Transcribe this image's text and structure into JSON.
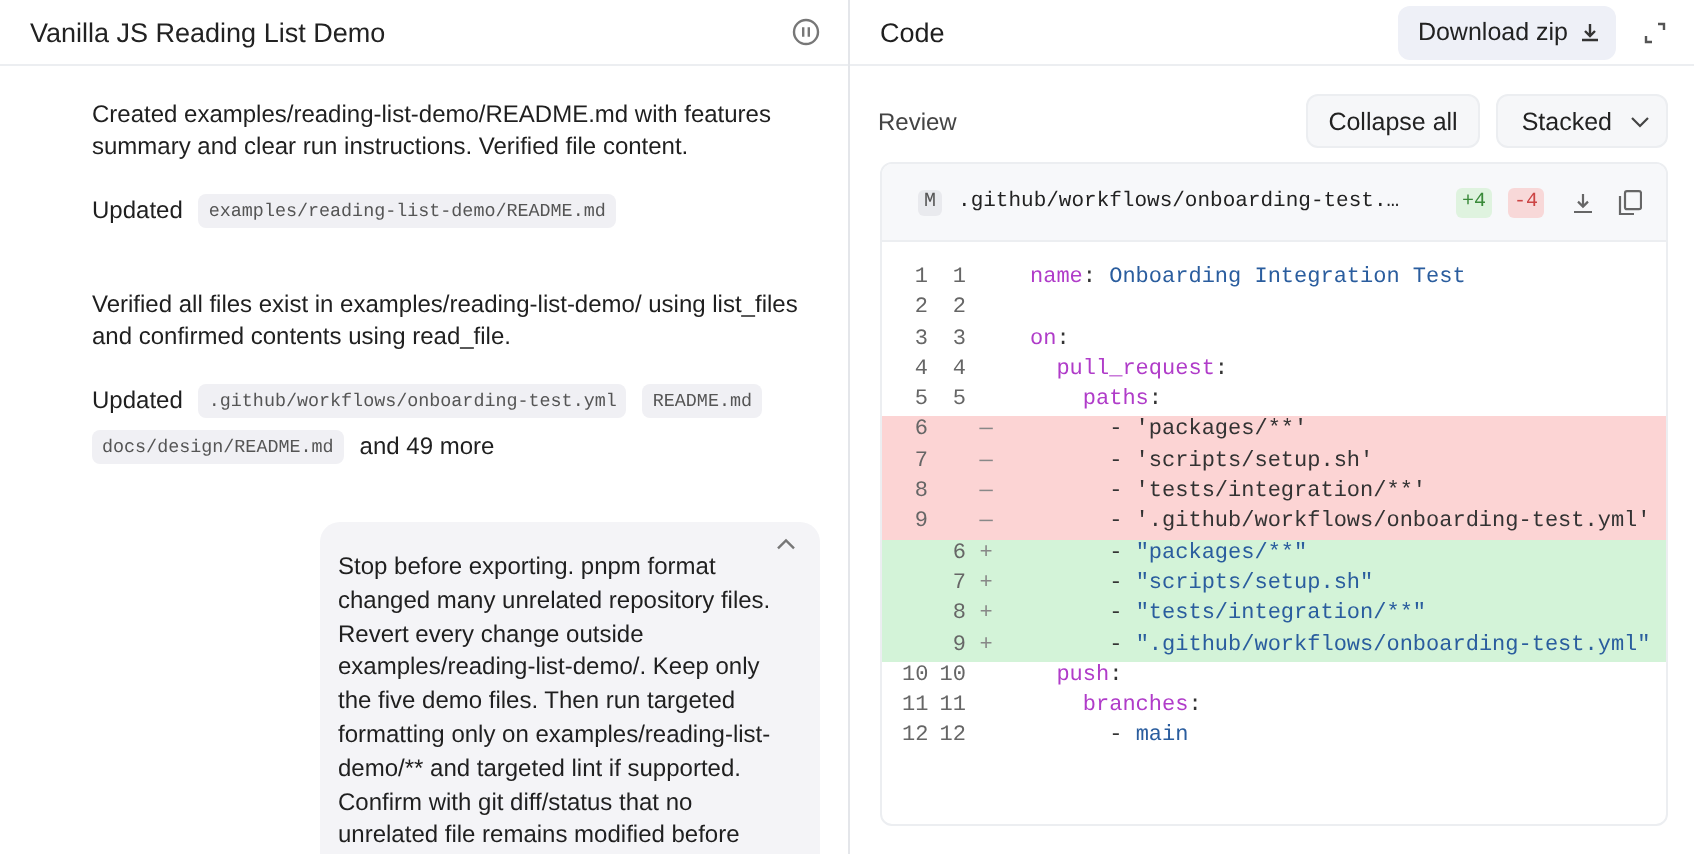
{
  "chat": {
    "title": "Vanilla JS Reading List Demo",
    "messages": [
      {
        "kind": "summary",
        "text": "Created examples/reading-list-demo/README.md with features summary and clear run instructions. Verified file content."
      },
      {
        "kind": "updated",
        "label": "Updated",
        "files": [
          "examples/reading-list-demo/README.md"
        ]
      },
      {
        "kind": "summary",
        "text": "Verified all files exist in examples/reading-list-demo/ using list_files and confirmed contents using read_file."
      },
      {
        "kind": "updated",
        "label": "Updated",
        "files": [
          ".github/workflows/onboarding-test.yml",
          "README.md",
          "docs/design/README.md"
        ],
        "more": "and 49 more"
      },
      {
        "kind": "user",
        "expanded": true,
        "text": "Stop before exporting. pnpm format changed many unrelated repository files. Revert every change outside examples/reading-list-demo/. Keep only the five demo files. Then run targeted formatting only on examples/reading-list-demo/** and targeted lint if supported. Confirm with git diff/status that no unrelated file remains modified before"
      }
    ]
  },
  "code": {
    "title": "Code",
    "download_button": "Download zip",
    "review": {
      "label": "Review",
      "collapse_button": "Collapse all",
      "view_select": "Stacked"
    },
    "files": [
      {
        "status": "M",
        "path": ".github/workflows/onboarding-test.…",
        "added": "+4",
        "removed": "-4",
        "lines": [
          {
            "kind": "context",
            "old": "1",
            "new": "1",
            "tokens": [
              {
                "kind": "key",
                "text": "name"
              },
              {
                "kind": "punct",
                "text": ": "
              },
              {
                "kind": "value",
                "text": "Onboarding Integration Test"
              }
            ]
          },
          {
            "kind": "context",
            "old": "2",
            "new": "2"
          },
          {
            "kind": "context",
            "old": "3",
            "new": "3",
            "tokens": [
              {
                "kind": "key",
                "text": "on"
              },
              {
                "kind": "punct",
                "text": ":"
              }
            ]
          },
          {
            "kind": "context",
            "old": "4",
            "new": "4",
            "tokens": [
              {
                "kind": "key",
                "text": "  pull_request"
              },
              {
                "kind": "punct",
                "text": ":"
              }
            ]
          },
          {
            "kind": "context",
            "old": "5",
            "new": "5",
            "tokens": [
              {
                "kind": "key",
                "text": "    paths"
              },
              {
                "kind": "punct",
                "text": ":"
              }
            ]
          },
          {
            "kind": "removed",
            "old": "6",
            "marker": "—",
            "tokens": [
              {
                "kind": "punct",
                "text": "      - 'packages/**'"
              }
            ]
          },
          {
            "kind": "removed",
            "old": "7",
            "marker": "—",
            "tokens": [
              {
                "kind": "punct",
                "text": "      - 'scripts/setup.sh'"
              }
            ]
          },
          {
            "kind": "removed",
            "old": "8",
            "marker": "—",
            "tokens": [
              {
                "kind": "punct",
                "text": "      - 'tests/integration/**'"
              }
            ]
          },
          {
            "kind": "removed",
            "old": "9",
            "marker": "—",
            "tokens": [
              {
                "kind": "punct",
                "text": "      - '.github/workflows/onboarding-test.yml'"
              }
            ]
          },
          {
            "kind": "added",
            "new": "6",
            "marker": "+",
            "tokens": [
              {
                "kind": "punct",
                "text": "      - "
              },
              {
                "kind": "value",
                "text": "\"packages/**\""
              }
            ]
          },
          {
            "kind": "added",
            "new": "7",
            "marker": "+",
            "tokens": [
              {
                "kind": "punct",
                "text": "      - "
              },
              {
                "kind": "value",
                "text": "\"scripts/setup.sh\""
              }
            ]
          },
          {
            "kind": "added",
            "new": "8",
            "marker": "+",
            "tokens": [
              {
                "kind": "punct",
                "text": "      - "
              },
              {
                "kind": "value",
                "text": "\"tests/integration/**\""
              }
            ]
          },
          {
            "kind": "added",
            "new": "9",
            "marker": "+",
            "tokens": [
              {
                "kind": "punct",
                "text": "      - "
              },
              {
                "kind": "value",
                "text": "\".github/workflows/onboarding-test.yml\""
              }
            ]
          },
          {
            "kind": "context",
            "old": "10",
            "new": "10",
            "tokens": [
              {
                "kind": "key",
                "text": "  push"
              },
              {
                "kind": "punct",
                "text": ":"
              }
            ]
          },
          {
            "kind": "context",
            "old": "11",
            "new": "11",
            "tokens": [
              {
                "kind": "key",
                "text": "    branches"
              },
              {
                "kind": "punct",
                "text": ":"
              }
            ]
          },
          {
            "kind": "context",
            "old": "12",
            "new": "12",
            "tokens": [
              {
                "kind": "punct",
                "text": "      - "
              },
              {
                "kind": "value",
                "text": "main"
              }
            ]
          }
        ]
      }
    ]
  }
}
